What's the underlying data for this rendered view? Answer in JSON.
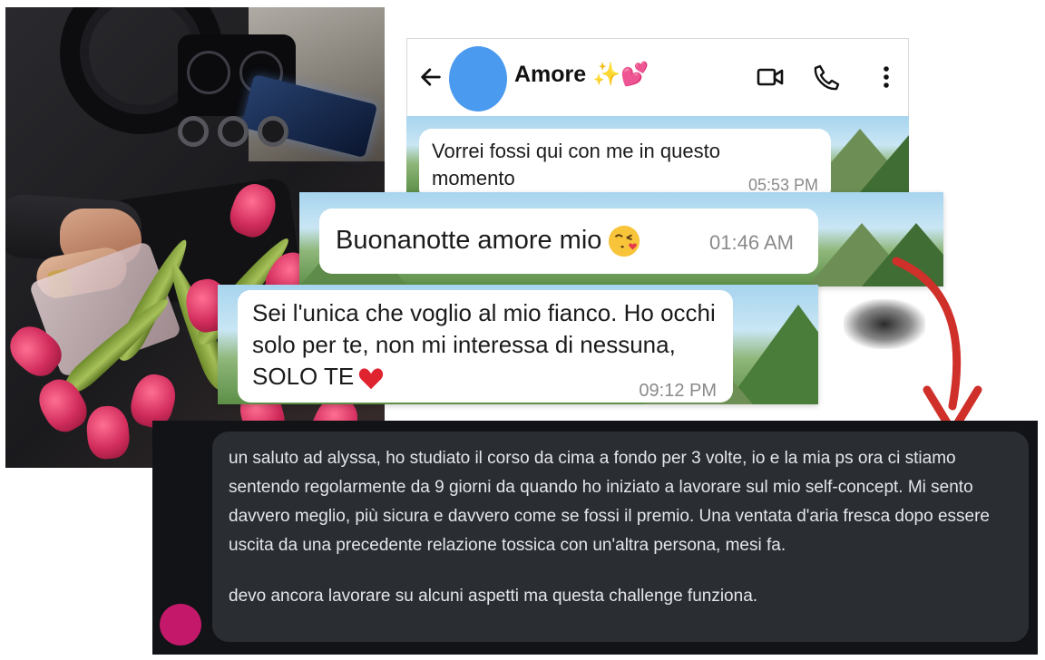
{
  "chat": {
    "contact_name": "Amore ✨💕",
    "messages": [
      {
        "text": "Vorrei fossi qui con me in questo momento",
        "time": "05:53 PM"
      },
      {
        "text": "Buonanotte amore mio",
        "emoji": "kissing-face-with-heart",
        "time": "01:46 AM"
      },
      {
        "text": "Sei l'unica che voglio al mio fianco. Ho occhi solo per te, non mi interessa di nessuna, SOLO TE",
        "emoji": "red-heart",
        "time": "09:12 PM"
      }
    ],
    "header_icons": [
      "back-arrow-icon",
      "video-call-icon",
      "phone-icon",
      "more-vertical-icon"
    ],
    "avatar_color": "#4a9af0"
  },
  "testimonial": {
    "paragraph1": "un saluto ad alyssa, ho studiato il corso da cima a fondo per 3 volte, io e la mia ps ora ci stiamo sentendo regolarmente da 9 giorni da quando ho iniziato a lavorare sul mio self-concept. Mi sento davvero meglio, più sicura e davvero come se fossi il premio. Una ventata d'aria fresca dopo essere uscita da una precedente relazione tossica con un'altra persona, mesi fa.",
    "paragraph2": "devo ancora lavorare su alcuni aspetti ma questa challenge funziona.",
    "avatar_color": "#c4196a"
  },
  "colors": {
    "arrow": "#d0302a",
    "dark_card": "#111317",
    "dark_bubble": "#2a2d32"
  }
}
